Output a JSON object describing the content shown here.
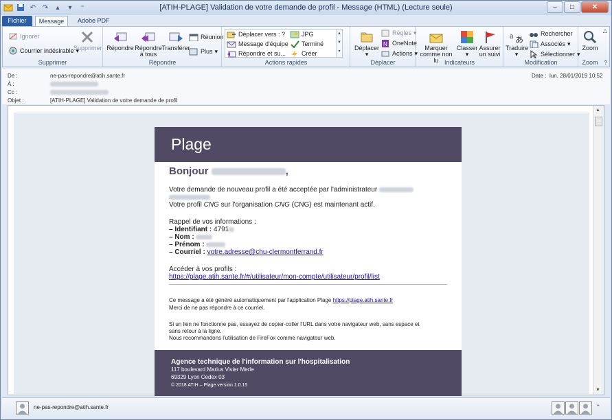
{
  "window": {
    "title": "[ATIH-PLAGE] Validation de votre demande de profil  -  Message (HTML) (Lecture seule)",
    "controls": {
      "minimize": "–",
      "maximize": "□",
      "close": "✕"
    }
  },
  "tabs": {
    "file": "Fichier",
    "message": "Message",
    "adobe": "Adobe PDF"
  },
  "ribbon": {
    "supprimer": {
      "ignorer": "Ignorer",
      "courrier": "Courrier indésirable",
      "supprimer": "Supprimer",
      "label": "Supprimer"
    },
    "repondre": {
      "repondre": "Répondre",
      "repondre_tous_1": "Répondre",
      "repondre_tous_2": "à tous",
      "transferer": "Transférer",
      "reunion": "Réunion",
      "plus": "Plus",
      "label": "Répondre"
    },
    "actions_rapides": {
      "items": [
        "Déplacer vers : ?",
        "Message d'équipe",
        "Répondre et su...",
        "JPG",
        "Terminé",
        "Créer"
      ],
      "label": "Actions rapides"
    },
    "deplacer": {
      "deplacer": "Déplacer",
      "regles": "Règles",
      "onenote": "OneNote",
      "actions": "Actions",
      "label": "Déplacer"
    },
    "indicateurs": {
      "marquer_1": "Marquer",
      "marquer_2": "comme non lu",
      "classer": "Classer",
      "assurer_1": "Assurer",
      "assurer_2": "un suivi",
      "label": "Indicateurs"
    },
    "modification": {
      "traduire": "Traduire",
      "rechercher": "Rechercher",
      "associes": "Associés",
      "selectionner": "Sélectionner",
      "label": "Modification"
    },
    "zoom": {
      "zoom": "Zoom",
      "label": "Zoom"
    }
  },
  "header": {
    "de_label": "De :",
    "de_value": "ne-pas-repondre@atih.sante.fr",
    "a_label": "À :",
    "cc_label": "Cc :",
    "objet_label": "Objet :",
    "objet_value": "[ATIH-PLAGE] Validation de votre demande de profil",
    "date_label": "Date :",
    "date_value": "lun. 28/01/2019 10:52"
  },
  "email": {
    "brand": "Plage",
    "greeting": "Bonjour",
    "greeting_end": ",",
    "line1": "Votre demande de nouveau profil a été acceptée par l'administrateur",
    "line2_a": "Votre profil ",
    "line2_profile": "CNG",
    "line2_b": " sur l'organisation ",
    "line2_org": "CNG",
    "line2_c": " (CNG) est maintenant actif.",
    "rappel": "Rappel de vos informations :",
    "identifiant_label": "– Identifiant :",
    "identifiant_value": "4791",
    "nom_label": "– Nom :",
    "prenom_label": "– Prénom :",
    "courriel_label": "– Courriel :",
    "courriel_value": "votre.adresse@chu-clermontferrand.fr",
    "acceder": "Accéder à vos profils :",
    "profil_link": "https://plage.atih.sante.fr/#/utilisateur/mon-compte/utilisateur/profil/list",
    "auto_a": "Ce message a été généré automatiquement par l'application Plage ",
    "auto_link": "https://plage.atih.sante.fr",
    "noreply": "Merci de ne pas répondre à ce courriel.",
    "help1": "Si un lien ne fonctionne pas, essayez de copier-coller l'URL dans votre navigateur web, sans espace et",
    "help2": "sans retour à la ligne.",
    "help3": "Nous recommandons l'utilisation de FireFox comme navigateur web.",
    "footer_org": "Agence technique de l'information sur l'hospitalisation",
    "footer_addr1": "117 boulevard Marius Vivier Merle",
    "footer_addr2": "69329 Lyon Cedex 03",
    "footer_copy": "© 2018 ATIH – Plage version 1.0.15"
  },
  "people": {
    "sender": "ne-pas-repondre@atih.sante.fr"
  },
  "colors": {
    "brand_bg": "#524a64",
    "link": "#1a0dab",
    "file_tab": "#2b5ea6"
  }
}
